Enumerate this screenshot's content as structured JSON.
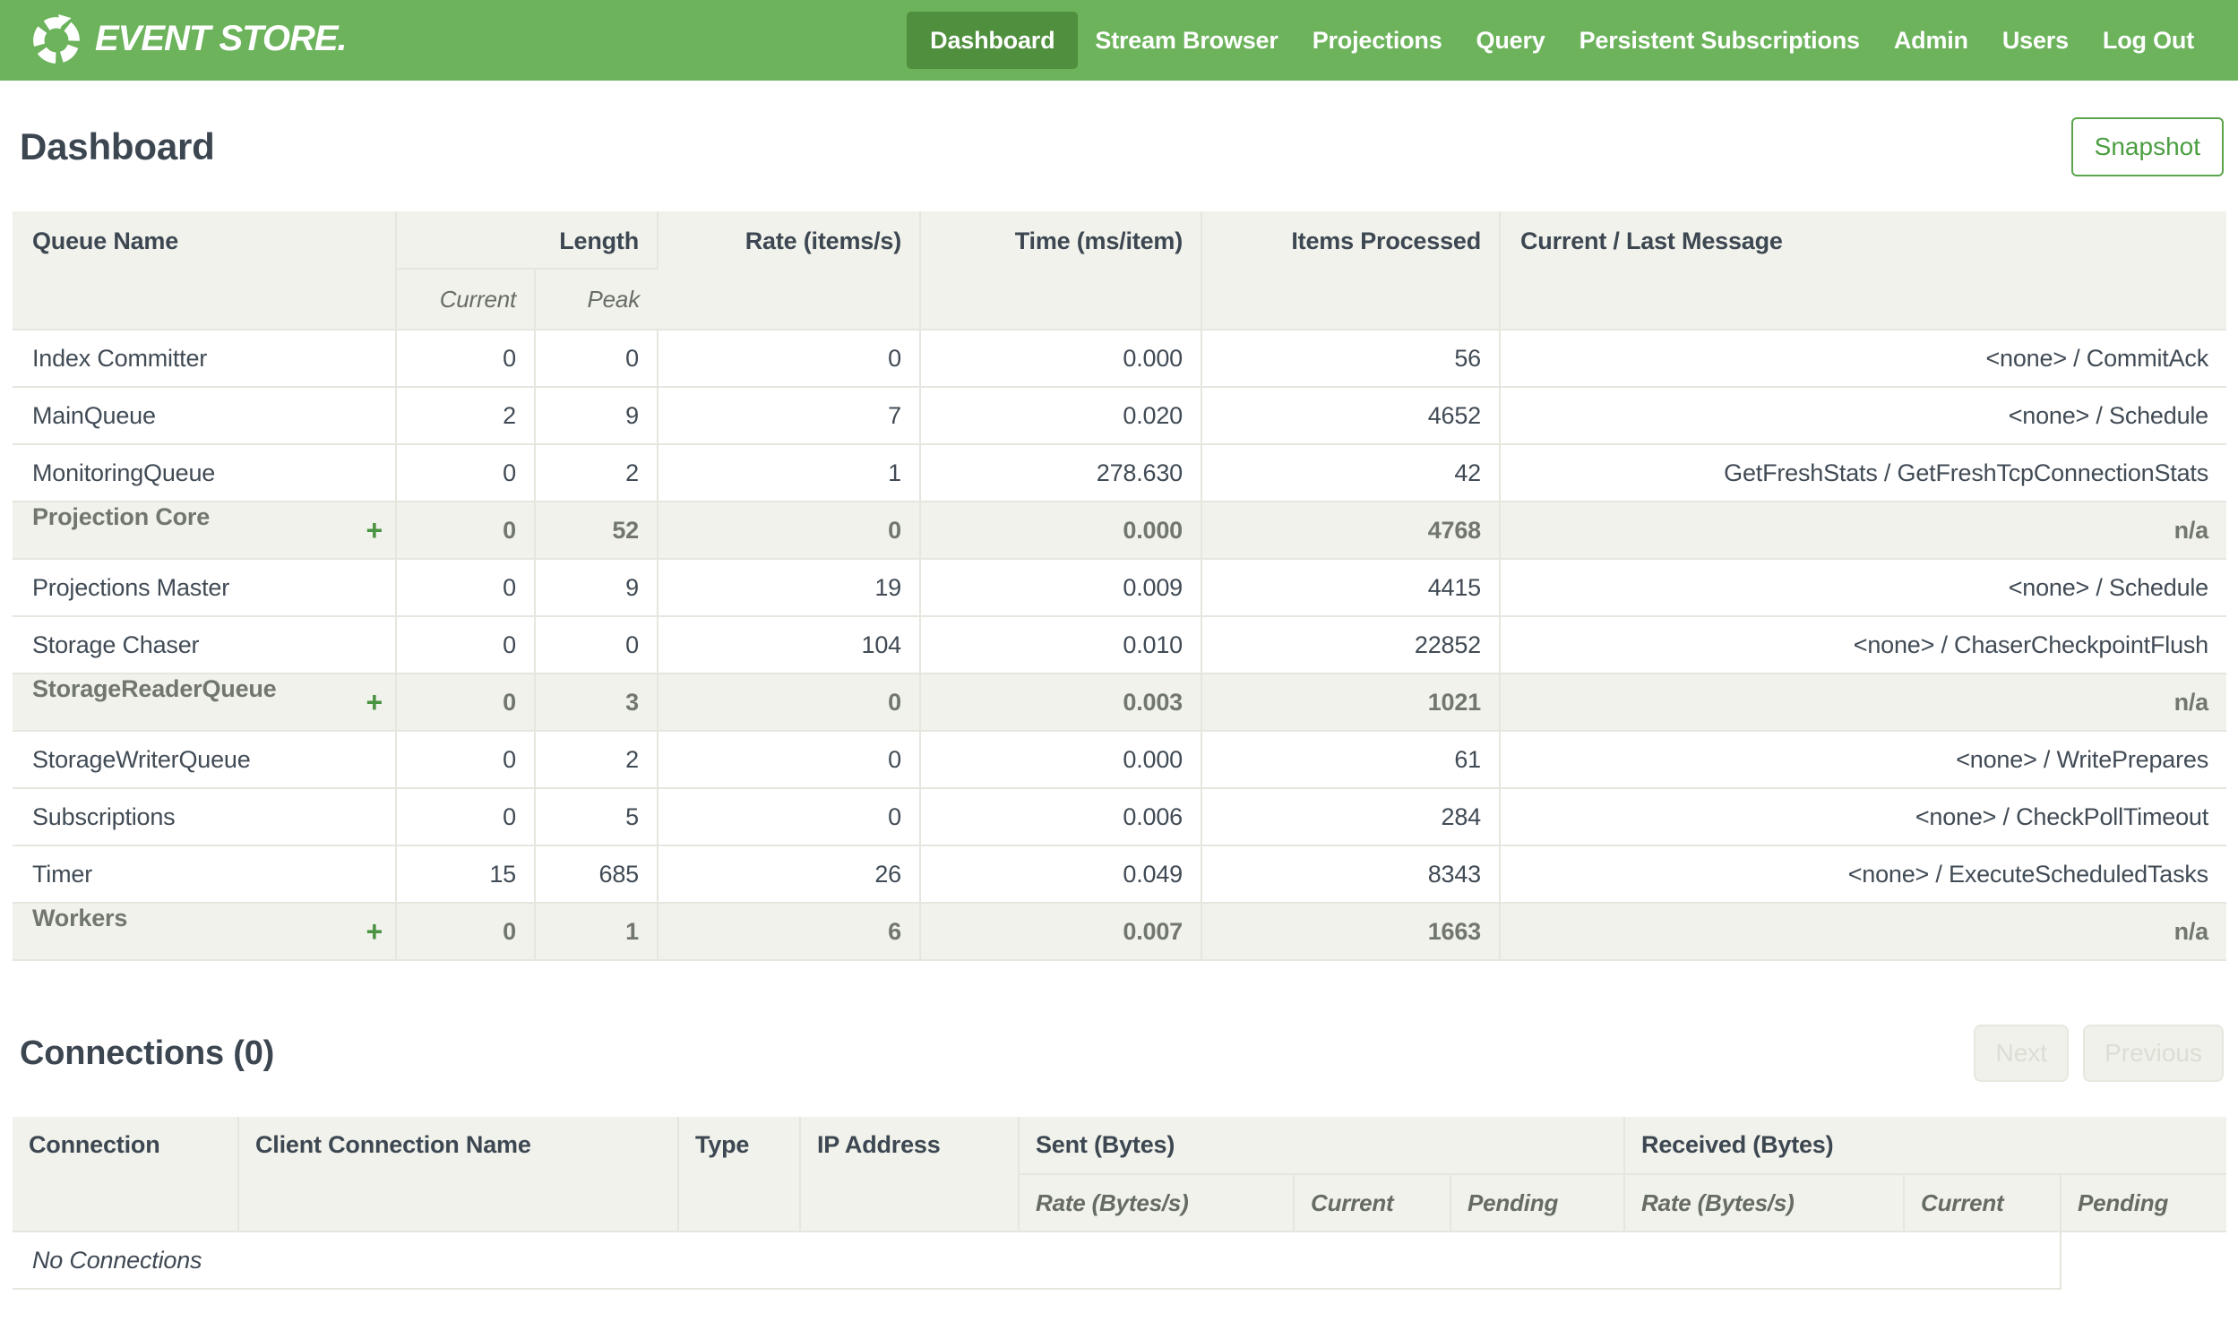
{
  "colors": {
    "navbar_green": "#6cb35c",
    "active_green": "#4f8f3e",
    "accent_green": "#4a9e41",
    "header_bg": "#f0f2eb",
    "text_dark": "#414b55"
  },
  "icons": {
    "expand": "+",
    "logo": "eventstore-circular-arrows"
  },
  "navbar": {
    "brand": "EVENT STORE.",
    "items": [
      {
        "label": "Dashboard",
        "active": true
      },
      {
        "label": "Stream Browser",
        "active": false
      },
      {
        "label": "Projections",
        "active": false
      },
      {
        "label": "Query",
        "active": false
      },
      {
        "label": "Persistent Subscriptions",
        "active": false
      },
      {
        "label": "Admin",
        "active": false
      },
      {
        "label": "Users",
        "active": false
      },
      {
        "label": "Log Out",
        "active": false
      }
    ]
  },
  "page": {
    "title": "Dashboard",
    "snapshot_label": "Snapshot"
  },
  "queue_table": {
    "headers": {
      "queue_name": "Queue Name",
      "length": "Length",
      "current": "Current",
      "peak": "Peak",
      "rate": "Rate (items/s)",
      "time": "Time (ms/item)",
      "items_processed": "Items Processed",
      "message": "Current / Last Message"
    },
    "rows": [
      {
        "name": "Index Committer",
        "group": false,
        "current": "0",
        "peak": "0",
        "rate": "0",
        "time": "0.000",
        "items": "56",
        "message": "<none> / CommitAck"
      },
      {
        "name": "MainQueue",
        "group": false,
        "current": "2",
        "peak": "9",
        "rate": "7",
        "time": "0.020",
        "items": "4652",
        "message": "<none> / Schedule"
      },
      {
        "name": "MonitoringQueue",
        "group": false,
        "current": "0",
        "peak": "2",
        "rate": "1",
        "time": "278.630",
        "items": "42",
        "message": "GetFreshStats / GetFreshTcpConnectionStats"
      },
      {
        "name": "Projection Core",
        "group": true,
        "current": "0",
        "peak": "52",
        "rate": "0",
        "time": "0.000",
        "items": "4768",
        "message": "n/a"
      },
      {
        "name": "Projections Master",
        "group": false,
        "current": "0",
        "peak": "9",
        "rate": "19",
        "time": "0.009",
        "items": "4415",
        "message": "<none> / Schedule"
      },
      {
        "name": "Storage Chaser",
        "group": false,
        "current": "0",
        "peak": "0",
        "rate": "104",
        "time": "0.010",
        "items": "22852",
        "message": "<none> / ChaserCheckpointFlush"
      },
      {
        "name": "StorageReaderQueue",
        "group": true,
        "current": "0",
        "peak": "3",
        "rate": "0",
        "time": "0.003",
        "items": "1021",
        "message": "n/a"
      },
      {
        "name": "StorageWriterQueue",
        "group": false,
        "current": "0",
        "peak": "2",
        "rate": "0",
        "time": "0.000",
        "items": "61",
        "message": "<none> / WritePrepares"
      },
      {
        "name": "Subscriptions",
        "group": false,
        "current": "0",
        "peak": "5",
        "rate": "0",
        "time": "0.006",
        "items": "284",
        "message": "<none> / CheckPollTimeout"
      },
      {
        "name": "Timer",
        "group": false,
        "current": "15",
        "peak": "685",
        "rate": "26",
        "time": "0.049",
        "items": "8343",
        "message": "<none> / ExecuteScheduledTasks"
      },
      {
        "name": "Workers",
        "group": true,
        "current": "0",
        "peak": "1",
        "rate": "6",
        "time": "0.007",
        "items": "1663",
        "message": "n/a"
      }
    ]
  },
  "connections": {
    "title": "Connections (0)",
    "next_label": "Next",
    "prev_label": "Previous",
    "headers": {
      "connection": "Connection",
      "client_name": "Client Connection Name",
      "type": "Type",
      "ip": "IP Address",
      "sent": "Sent (Bytes)",
      "received": "Received (Bytes)"
    },
    "subheaders": {
      "rate": "Rate (Bytes/s)",
      "current": "Current",
      "pending": "Pending"
    },
    "empty_message": "No Connections"
  }
}
